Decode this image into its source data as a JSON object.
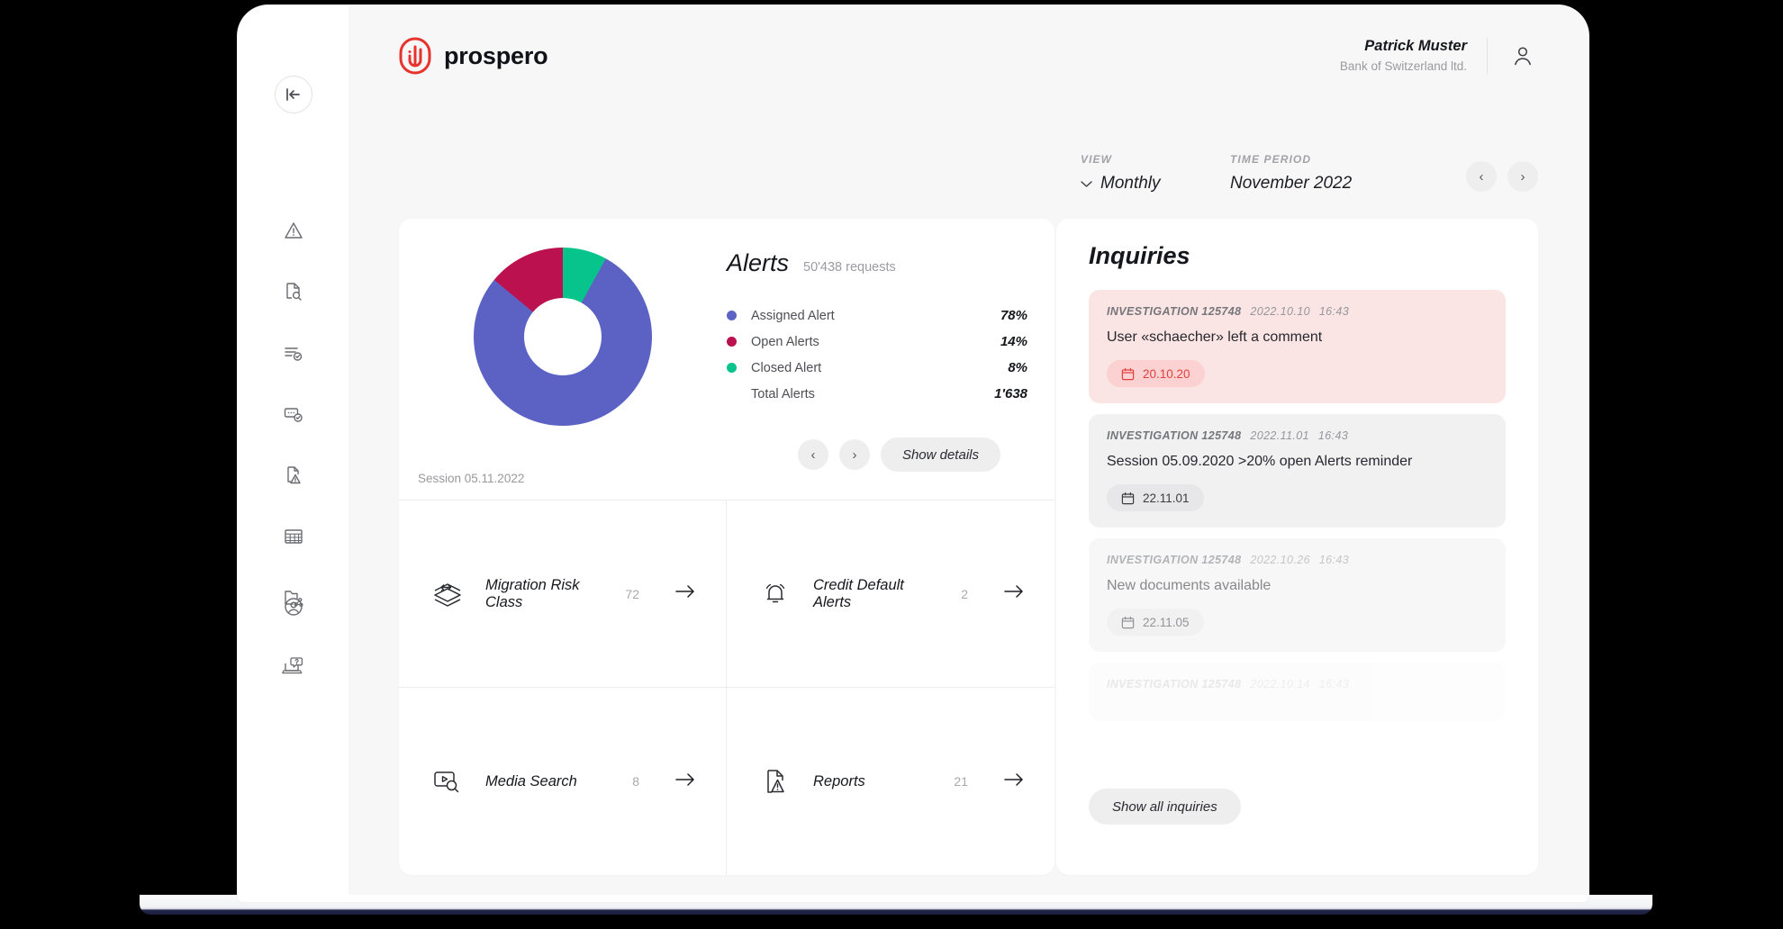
{
  "brand": {
    "name": "prospero",
    "mark": "fingerprint-logo"
  },
  "user": {
    "name": "Patrick Muster",
    "org": "Bank of Switzerland ltd."
  },
  "sidebar": {
    "collapse_label": "collapse-sidebar",
    "items": [
      {
        "icon": "warning-triangle-icon",
        "name": "alerts"
      },
      {
        "icon": "document-search-icon",
        "name": "document-search"
      },
      {
        "icon": "list-check-icon",
        "name": "checklist"
      },
      {
        "icon": "card-check-icon",
        "name": "transactions"
      },
      {
        "icon": "document-warning-icon",
        "name": "risk-documents"
      },
      {
        "icon": "table-grid-icon",
        "name": "data-table"
      },
      {
        "icon": "folder-share-icon",
        "name": "shared-folders"
      }
    ],
    "bottom_items": [
      {
        "icon": "user-circle-icon",
        "name": "account"
      },
      {
        "icon": "laptop-help-icon",
        "name": "support"
      }
    ]
  },
  "filters": {
    "view_label": "VIEW",
    "view_value": "Monthly",
    "period_label": "TIME PERIOD",
    "period_value": "November 2022",
    "prev": "‹",
    "next": "›"
  },
  "alerts": {
    "title": "Alerts",
    "subtitle": "50'438 requests",
    "session": "Session 05.11.2022",
    "prev": "‹",
    "next": "›",
    "show_details": "Show details",
    "total_label": "Total Alerts",
    "total_value": "1'638"
  },
  "chart_data": {
    "type": "pie",
    "title": "Alerts",
    "subtitle": "50'438 requests",
    "categories": [
      "Assigned Alert",
      "Open Alerts",
      "Closed Alert"
    ],
    "values": [
      78,
      14,
      8
    ],
    "value_labels": [
      "78%",
      "14%",
      "8%"
    ],
    "colors": [
      "#5b62c4",
      "#bc114f",
      "#06c48b"
    ],
    "donut": true,
    "legend": "right",
    "total": {
      "label": "Total Alerts",
      "value": "1'638"
    }
  },
  "tiles": [
    {
      "icon": "layers-migration-icon",
      "label": "Migration Risk Class",
      "count": "72",
      "arrow": "→"
    },
    {
      "icon": "bell-alert-icon",
      "label": "Credit Default Alerts",
      "count": "2",
      "arrow": "→"
    },
    {
      "icon": "media-search-icon",
      "label": "Media Search",
      "count": "8",
      "arrow": "→"
    },
    {
      "icon": "report-warning-icon",
      "label": "Reports",
      "count": "21",
      "arrow": "→"
    }
  ],
  "inquiries": {
    "title": "Inquiries",
    "show_all": "Show all inquiries",
    "cards": [
      {
        "ref": "INVESTIGATION 125748",
        "date": "2022.10.10",
        "time": "16:43",
        "text": "User «schaecher» left a comment",
        "badge": "20.10.20",
        "style": "alert"
      },
      {
        "ref": "INVESTIGATION 125748",
        "date": "2022.11.01",
        "time": "16:43",
        "text": "Session 05.09.2020 >20% open Alerts reminder",
        "badge": "22.11.01",
        "style": "normal"
      },
      {
        "ref": "INVESTIGATION 125748",
        "date": "2022.10.26",
        "time": "16:43",
        "text": "New documents available",
        "badge": "22.11.05",
        "style": "normal"
      },
      {
        "ref": "INVESTIGATION 125748",
        "date": "2022.10.14",
        "time": "16:43",
        "text": "",
        "badge": "",
        "style": "normal"
      }
    ]
  },
  "colors": {
    "accent_red": "#e2403f",
    "assigned": "#5b62c4",
    "open": "#bc114f",
    "closed": "#06c48b",
    "page_bg": "#f7f7f8"
  }
}
